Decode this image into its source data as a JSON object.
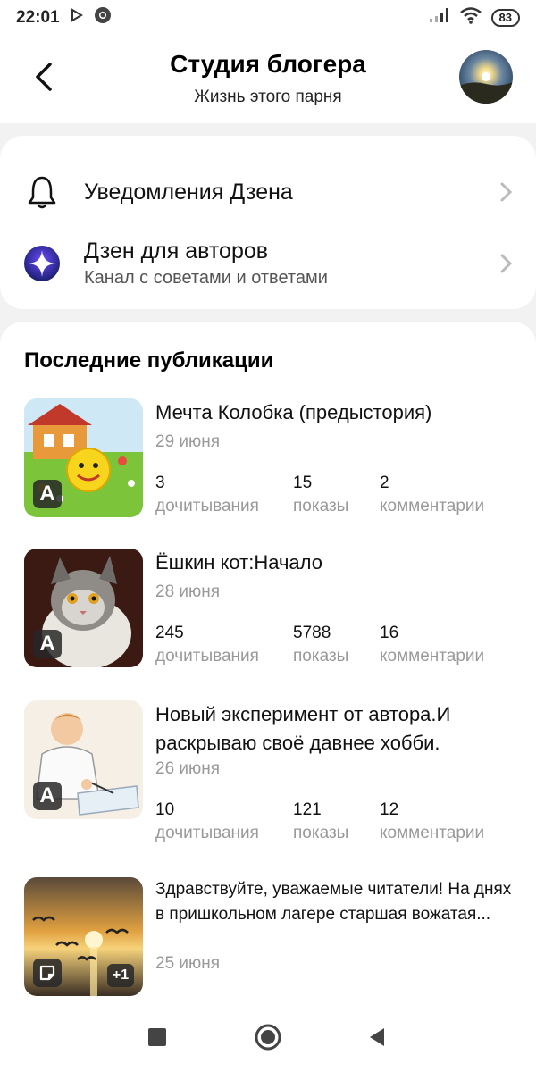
{
  "status_bar": {
    "time": "22:01",
    "battery": "83"
  },
  "header": {
    "title": "Студия блогера",
    "subtitle": "Жизнь этого парня"
  },
  "menu": [
    {
      "title": "Уведомления Дзена",
      "subtitle": "",
      "icon": "bell-icon"
    },
    {
      "title": "Дзен для авторов",
      "subtitle": "Канал с советами и ответами",
      "icon": "zen-star-icon"
    }
  ],
  "publications": {
    "heading": "Последние публикации",
    "items": [
      {
        "title": "Мечта Колобка (предыстория)",
        "date": "29 июня",
        "badge": "A",
        "stats": [
          {
            "value": "3",
            "label": "дочитывания"
          },
          {
            "value": "15",
            "label": "показы"
          },
          {
            "value": "2",
            "label": "комментарии"
          }
        ]
      },
      {
        "title": "Ёшкин кот:Начало",
        "date": "28 июня",
        "badge": "A",
        "stats": [
          {
            "value": "245",
            "label": "дочитывания"
          },
          {
            "value": "5788",
            "label": "показы"
          },
          {
            "value": "16",
            "label": "комментарии"
          }
        ]
      },
      {
        "title": "Новый эксперимент от автора.И раскрываю своё давнее хобби.",
        "date": "26 июня",
        "badge": "A",
        "stats": [
          {
            "value": "10",
            "label": "дочитывания"
          },
          {
            "value": "121",
            "label": "показы"
          },
          {
            "value": "12",
            "label": "комментарии"
          }
        ]
      },
      {
        "title": "Здравствуйте, уважаемые читатели! На днях в пришкольном лагере старшая вожатая...",
        "date": "25 июня",
        "plus": "+1"
      }
    ]
  }
}
